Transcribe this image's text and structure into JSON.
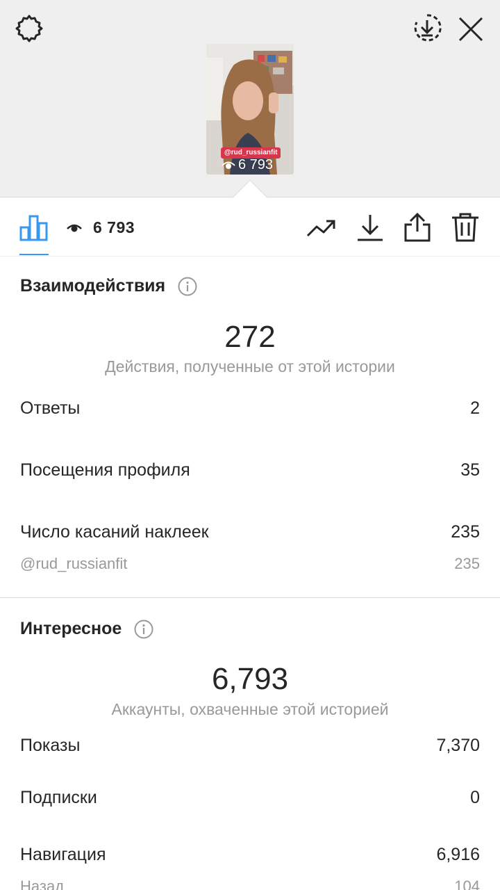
{
  "story": {
    "mention": "@rud_russianfit",
    "views": "6 793"
  },
  "toolbar": {
    "views": "6 793"
  },
  "interactions": {
    "title": "Взаимодействия",
    "total": "272",
    "caption": "Действия, полученные от этой истории",
    "rows": [
      {
        "label": "Ответы",
        "value": "2"
      },
      {
        "label": "Посещения профиля",
        "value": "35"
      },
      {
        "label": "Число касаний наклеек",
        "value": "235"
      }
    ],
    "sticker": {
      "label": "@rud_russianfit",
      "value": "235"
    }
  },
  "discovery": {
    "title": "Интересное",
    "total": "6,793",
    "caption": "Аккаунты, охваченные этой историей",
    "rows": [
      {
        "label": "Показы",
        "value": "7,370"
      },
      {
        "label": "Подписки",
        "value": "0"
      },
      {
        "label": "Навигация",
        "value": "6,916"
      }
    ],
    "back": {
      "label": "Назад",
      "value": "104"
    }
  },
  "colors": {
    "accent": "#3897f0",
    "mention_bg": "#d6374d",
    "secondary_text": "#999999"
  },
  "icons": [
    "settings-icon",
    "save-download-circle-icon",
    "close-icon",
    "eye-icon",
    "bar-chart-icon",
    "trending-icon",
    "download-icon",
    "share-icon",
    "trash-icon",
    "info-icon"
  ]
}
